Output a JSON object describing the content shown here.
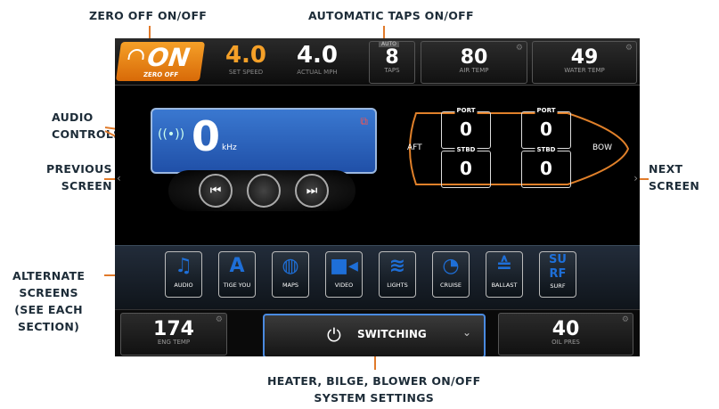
{
  "callouts": {
    "zero_off": "ZERO OFF ON/OFF",
    "auto_taps": "AUTOMATIC TAPS ON/OFF",
    "audio": [
      "AUDIO",
      "CONTROLS"
    ],
    "previous": [
      "PREVIOUS",
      "SCREEN"
    ],
    "next": [
      "NEXT",
      "SCREEN"
    ],
    "alternate": [
      "ALTERNATE",
      "SCREENS",
      "(SEE EACH",
      "SECTION)"
    ],
    "bottom": [
      "HEATER, BILGE, BLOWER ON/OFF",
      "SYSTEM SETTINGS"
    ]
  },
  "topbar": {
    "zero_off_button": {
      "state": "ON",
      "label": "ZERO OFF"
    },
    "set_speed": {
      "value": "4.0",
      "label": "SET SPEED",
      "color": "#f5a028"
    },
    "actual_mph": {
      "value": "4.0",
      "label": "ACTUAL MPH",
      "color": "#ffffff"
    },
    "taps": {
      "value": "8",
      "label": "TAPS",
      "badge": "AUTO"
    },
    "air_temp": {
      "value": "80",
      "label": "AIR TEMP"
    },
    "water_temp": {
      "value": "49",
      "label": "WATER TEMP"
    }
  },
  "audio": {
    "frequency": "0",
    "unit": "kHz"
  },
  "ballast": {
    "aft_label": "AFT",
    "bow_label": "BOW",
    "aft_port": {
      "label": "PORT",
      "value": "0"
    },
    "aft_stbd": {
      "label": "STBD",
      "value": "0"
    },
    "bow_port": {
      "label": "PORT",
      "value": "0"
    },
    "bow_stbd": {
      "label": "STBD",
      "value": "0"
    }
  },
  "dock": [
    {
      "label": "AUDIO",
      "icon": "music-icon"
    },
    {
      "label": "TIGE YOU",
      "icon": "tige-logo-icon"
    },
    {
      "label": "MAPS",
      "icon": "globe-icon"
    },
    {
      "label": "VIDEO",
      "icon": "video-camera-icon"
    },
    {
      "label": "LIGHTS",
      "icon": "lights-icon"
    },
    {
      "label": "CRUISE",
      "icon": "speedometer-icon"
    },
    {
      "label": "BALLAST",
      "icon": "ballast-icon"
    },
    {
      "label": "SURF",
      "icon": "surf-icon"
    }
  ],
  "bottombar": {
    "eng_temp": {
      "value": "174",
      "label": "ENG TEMP"
    },
    "switching": "SWITCHING",
    "oil_pres": {
      "value": "40",
      "label": "OIL PRES"
    }
  },
  "colors": {
    "accent_orange": "#e07a2a",
    "callout_text": "#1d2c38",
    "audio_blue": "#2a62c0"
  }
}
